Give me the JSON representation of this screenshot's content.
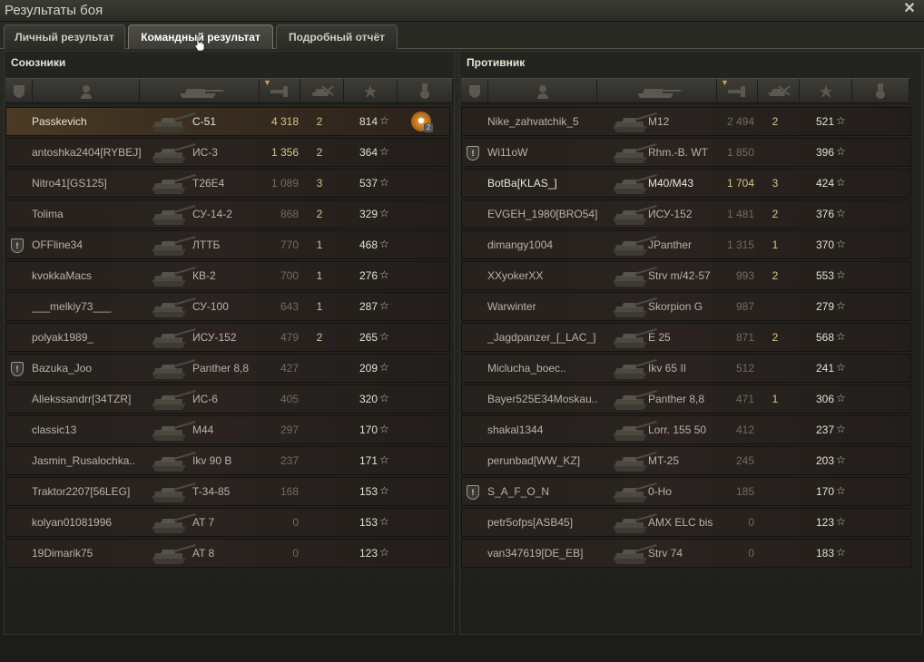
{
  "window": {
    "title": "Результаты боя",
    "close_icon": "close-icon"
  },
  "tabs": [
    {
      "label": "Личный результат",
      "active": false
    },
    {
      "label": "Командный результат",
      "active": true
    },
    {
      "label": "Подробный отчёт",
      "active": false
    }
  ],
  "allies": {
    "title": "Союзники",
    "rows": [
      {
        "player": "Passkevich",
        "tank": "С-51",
        "damage": "4 318",
        "kills": "2",
        "xp": "814",
        "medal": "2",
        "me": true,
        "dmg_hi": true
      },
      {
        "player": "antoshka2404[RYBEJ]",
        "tank": "ИС-3",
        "damage": "1 356",
        "kills": "2",
        "xp": "364",
        "dmg_hi": true
      },
      {
        "player": "Nitro41[GS125]",
        "tank": "T26E4",
        "damage": "1 089",
        "kills": "3",
        "xp": "537"
      },
      {
        "player": "Tolima",
        "tank": "СУ-14-2",
        "damage": "868",
        "kills": "2",
        "xp": "329"
      },
      {
        "player": "OFFline34",
        "tank": "ЛТТБ",
        "damage": "770",
        "kills": "1",
        "xp": "468",
        "shield": true
      },
      {
        "player": "kvokkaMacs",
        "tank": "КВ-2",
        "damage": "700",
        "kills": "1",
        "xp": "276"
      },
      {
        "player": "___melkiy73___",
        "tank": "СУ-100",
        "damage": "643",
        "kills": "1",
        "xp": "287"
      },
      {
        "player": "polyak1989_",
        "tank": "ИСУ-152",
        "damage": "479",
        "kills": "2",
        "xp": "265"
      },
      {
        "player": "Bazuka_Joo",
        "tank": "Panther 8,8",
        "damage": "427",
        "kills": "",
        "xp": "209",
        "shield": true
      },
      {
        "player": "Allekssandrr[34TZR]",
        "tank": "ИС-6",
        "damage": "405",
        "kills": "",
        "xp": "320"
      },
      {
        "player": "classic13",
        "tank": "M44",
        "damage": "297",
        "kills": "",
        "xp": "170"
      },
      {
        "player": "Jasmin_Rusalochka..",
        "tank": "Ikv 90 B",
        "damage": "237",
        "kills": "",
        "xp": "171"
      },
      {
        "player": "Traktor2207[56LEG]",
        "tank": "T-34-85",
        "damage": "168",
        "kills": "",
        "xp": "153"
      },
      {
        "player": "kolyan01081996",
        "tank": "AT 7",
        "damage": "0",
        "kills": "",
        "xp": "153"
      },
      {
        "player": "19Dimarik75",
        "tank": "AT 8",
        "damage": "0",
        "kills": "",
        "xp": "123"
      }
    ]
  },
  "enemies": {
    "title": "Противник",
    "rows": [
      {
        "player": "Nike_zahvatchik_5",
        "tank": "M12",
        "damage": "2 494",
        "kills": "2",
        "xp": "521"
      },
      {
        "player": "Wi11oW",
        "tank": "Rhm.-B. WT",
        "damage": "1 850",
        "kills": "",
        "xp": "396",
        "shield": true
      },
      {
        "player": "BotBa[KLAS_]",
        "tank": "M40/M43",
        "damage": "1 704",
        "kills": "3",
        "xp": "424",
        "dmg_hi": true,
        "bright": true
      },
      {
        "player": "EVGEH_1980[BRO54]",
        "tank": "ИСУ-152",
        "damage": "1 481",
        "kills": "2",
        "xp": "376"
      },
      {
        "player": "dimangy1004",
        "tank": "JPanther",
        "damage": "1 315",
        "kills": "1",
        "xp": "370"
      },
      {
        "player": "XXyokerXX",
        "tank": "Strv m/42-57",
        "damage": "993",
        "kills": "2",
        "xp": "553"
      },
      {
        "player": "Warwinter",
        "tank": "Skorpion G",
        "damage": "987",
        "kills": "",
        "xp": "279"
      },
      {
        "player": "_Jagdpanzer_[_LAC_]",
        "tank": "E 25",
        "damage": "871",
        "kills": "2",
        "xp": "568"
      },
      {
        "player": "Miclucha_boec..",
        "tank": "Ikv 65 II",
        "damage": "512",
        "kills": "",
        "xp": "241"
      },
      {
        "player": "Bayer525E34Moskau..",
        "tank": "Panther 8,8",
        "damage": "471",
        "kills": "1",
        "xp": "306"
      },
      {
        "player": "shakal1344",
        "tank": "Lorr. 155 50",
        "damage": "412",
        "kills": "",
        "xp": "237"
      },
      {
        "player": "perunbad[WW_KZ]",
        "tank": "MT-25",
        "damage": "245",
        "kills": "",
        "xp": "203"
      },
      {
        "player": "S_A_F_O_N",
        "tank": "0-Ho",
        "damage": "185",
        "kills": "",
        "xp": "170",
        "shield": true
      },
      {
        "player": "petr5ofps[ASB45]",
        "tank": "AMX ELC bis",
        "damage": "0",
        "kills": "",
        "xp": "123"
      },
      {
        "player": "van347619[DE_EB]",
        "tank": "Strv 74",
        "damage": "0",
        "kills": "",
        "xp": "183"
      }
    ]
  },
  "columns": [
    "squad-icon",
    "player-icon",
    "tank-icon",
    "damage-icon",
    "kills-icon",
    "xp-star-icon",
    "medal-icon"
  ]
}
